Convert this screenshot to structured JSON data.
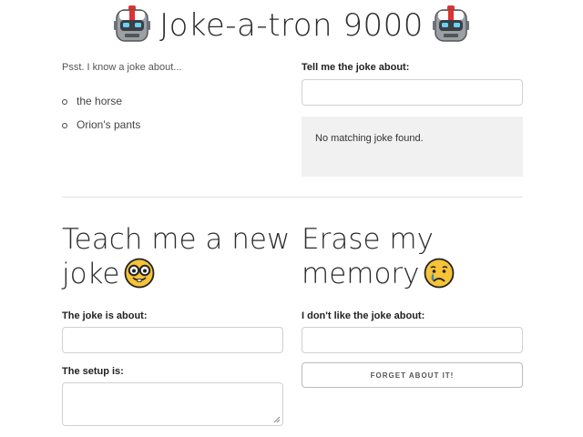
{
  "header": {
    "title": "Joke-a-tron 9000",
    "left_icon": "robot-icon",
    "right_icon": "robot-icon"
  },
  "know_section": {
    "intro": "Psst. I know a joke about...",
    "topics": [
      "the horse",
      "Orion's pants"
    ]
  },
  "tell_section": {
    "label": "Tell me the joke about:",
    "input_value": "",
    "result_text": "No matching joke found."
  },
  "teach_section": {
    "heading_line1": "Teach me a new",
    "heading_line2": "joke",
    "heading_icon": "nerd-face-icon",
    "about_label": "The joke is about:",
    "about_value": "",
    "setup_label": "The setup is:",
    "setup_value": ""
  },
  "erase_section": {
    "heading_line1": "Erase my",
    "heading_line2": "memory",
    "heading_icon": "crying-face-icon",
    "label": "I don't like the joke about:",
    "input_value": "",
    "button_label": "FORGET ABOUT IT!"
  },
  "colors": {
    "result_bg": "#f1f1f1",
    "border": "#d1d1d1",
    "emoji_yellow": "#f7c338",
    "tear_blue": "#3aa8e8"
  }
}
